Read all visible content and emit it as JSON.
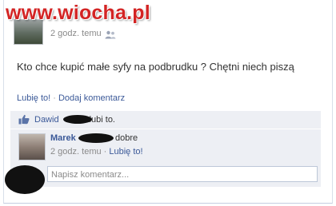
{
  "watermark": "www.wiocha.pl",
  "post": {
    "time": "2 godz. temu",
    "message": "Kto chce kupić małe syfy na podbrudku ? Chętni niech piszą"
  },
  "actions": {
    "like": "Lubię to!",
    "separator": " · ",
    "comment": "Dodaj komentarz"
  },
  "likes": {
    "name": "Dawid",
    "suffix": "lubi to."
  },
  "comment": {
    "author": "Marek",
    "text": "dobre",
    "time": "2 godz. temu",
    "separator": " · ",
    "like": "Lubię to!"
  },
  "comment_input": {
    "placeholder": "Napisz komentarz..."
  },
  "colors": {
    "link": "#3b5998",
    "ufi_background": "#edeff4",
    "watermark": "#d32424"
  }
}
